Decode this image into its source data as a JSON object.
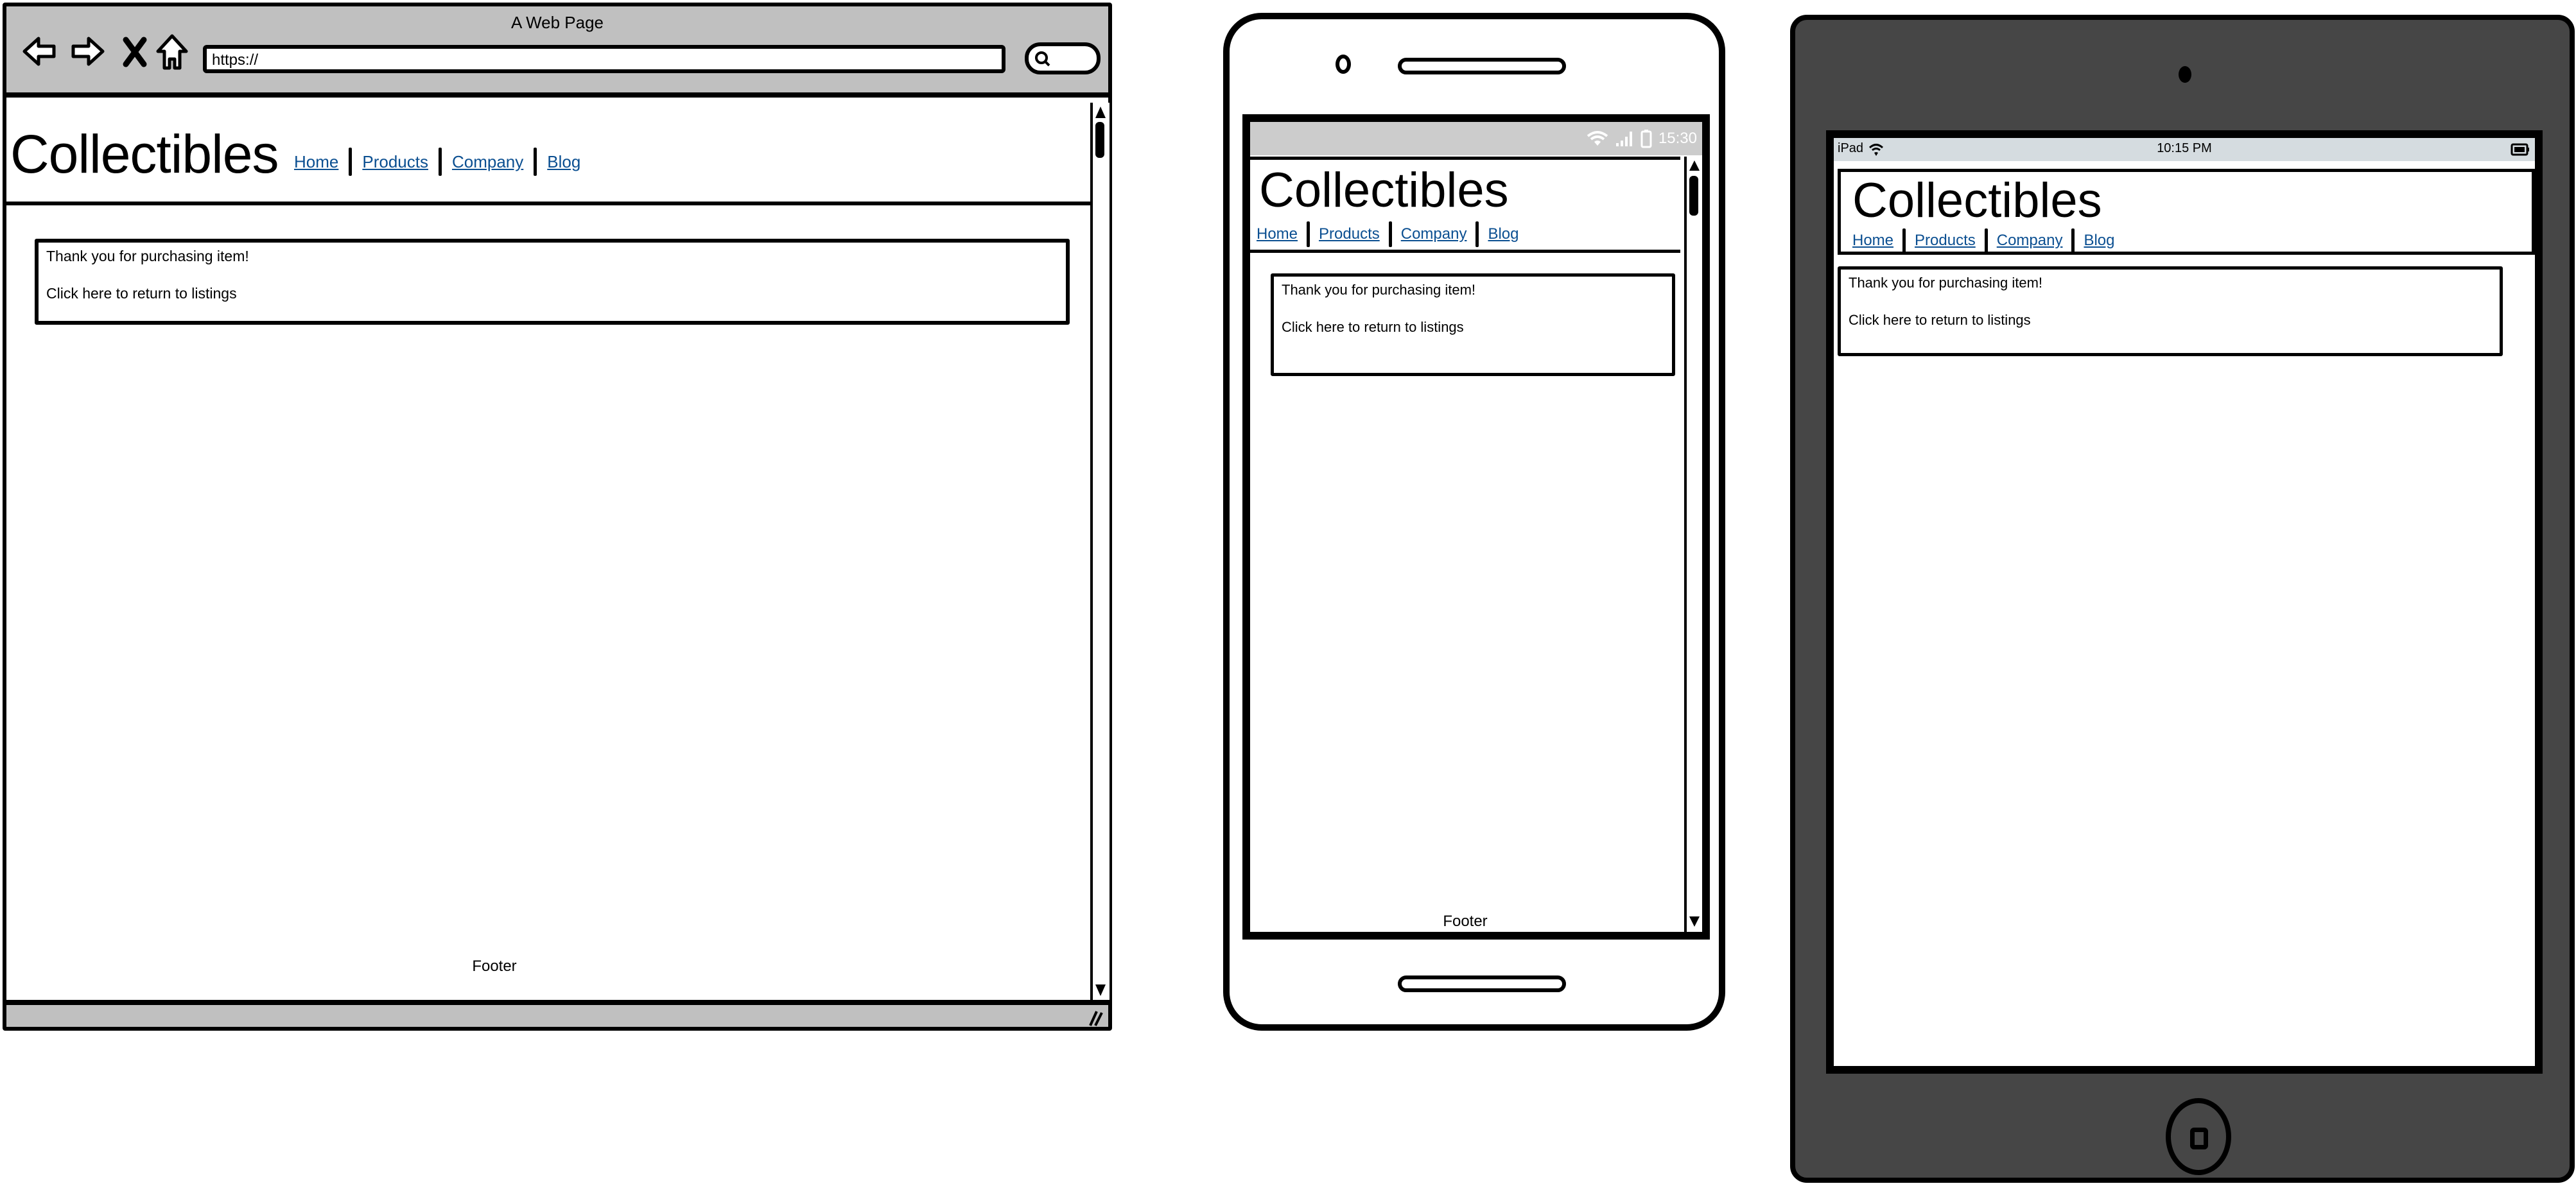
{
  "browser": {
    "window_title": "A Web Page",
    "url": "https://",
    "icons": [
      "back-arrow-icon",
      "forward-arrow-icon",
      "stop-icon",
      "home-icon",
      "search-icon",
      "resize-grip-icon"
    ],
    "site": {
      "logo": "Collectibles",
      "nav": [
        "Home",
        "Products",
        "Company",
        "Blog"
      ],
      "message_line1": "Thank you for purchasing item!",
      "message_line2": "Click here to return to listings",
      "footer": "Footer"
    }
  },
  "phone": {
    "status_time": "15:30",
    "status_icons": [
      "wifi-icon",
      "signal-icon",
      "battery-icon"
    ],
    "site": {
      "logo": "Collectibles",
      "nav": [
        "Home",
        "Products",
        "Company",
        "Blog"
      ],
      "message_line1": "Thank you for purchasing item!",
      "message_line2": "Click here to return to listings",
      "footer": "Footer"
    }
  },
  "tablet": {
    "status_device": "iPad",
    "status_time": "10:15 PM",
    "status_icons": [
      "wifi-icon",
      "battery-icon"
    ],
    "site": {
      "logo": "Collectibles",
      "nav": [
        "Home",
        "Products",
        "Company",
        "Blog"
      ],
      "message_line1": "Thank you for purchasing item!",
      "message_line2": "Click here to return to listings"
    }
  },
  "colors": {
    "link": "#0b4f91",
    "browser_chrome": "#c0c0c0",
    "phone_status": "#cccccc",
    "tablet_body": "#464646",
    "tablet_status": "#d5dce0"
  }
}
